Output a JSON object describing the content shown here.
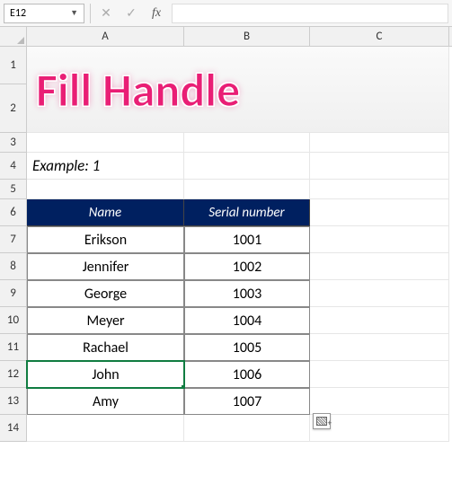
{
  "nameBox": {
    "value": "E12"
  },
  "formulaBar": {
    "cancel": "✕",
    "confirm": "✓",
    "fx": "fx",
    "value": ""
  },
  "columns": [
    "A",
    "B",
    "C"
  ],
  "rowNumbers": [
    "1",
    "2",
    "3",
    "4",
    "5",
    "6",
    "7",
    "8",
    "9",
    "10",
    "11",
    "12",
    "13",
    "14"
  ],
  "title": "Fill Handle",
  "example": "Example: 1",
  "headers": {
    "name": "Name",
    "serial": "Serial number"
  },
  "rows": [
    {
      "name": "Erikson",
      "serial": "1001"
    },
    {
      "name": "Jennifer",
      "serial": "1002"
    },
    {
      "name": "George",
      "serial": "1003"
    },
    {
      "name": "Meyer",
      "serial": "1004"
    },
    {
      "name": "Rachael",
      "serial": "1005"
    },
    {
      "name": "John",
      "serial": "1006"
    },
    {
      "name": "Amy",
      "serial": "1007"
    }
  ],
  "chart_data": {
    "type": "table",
    "title": "Fill Handle — Example: 1",
    "columns": [
      "Name",
      "Serial number"
    ],
    "rows": [
      [
        "Erikson",
        1001
      ],
      [
        "Jennifer",
        1002
      ],
      [
        "George",
        1003
      ],
      [
        "Meyer",
        1004
      ],
      [
        "Rachael",
        1005
      ],
      [
        "John",
        1006
      ],
      [
        "Amy",
        1007
      ]
    ]
  }
}
